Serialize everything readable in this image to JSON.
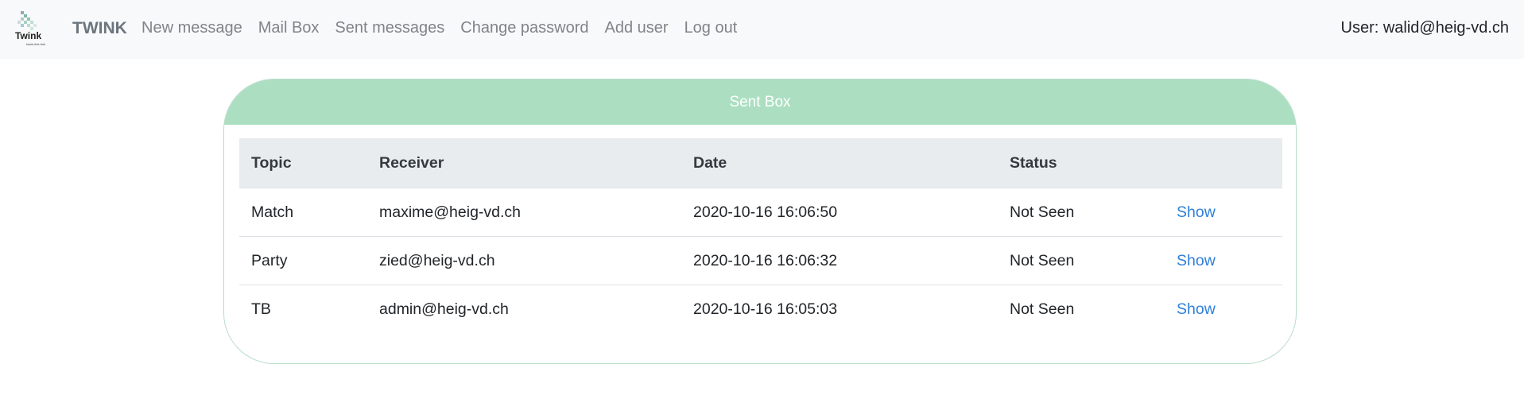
{
  "navbar": {
    "logo_text": "Twink",
    "logo_tagline": "twink-link-tink",
    "brand": "TWINK",
    "links": [
      {
        "label": "New message"
      },
      {
        "label": "Mail Box"
      },
      {
        "label": "Sent messages"
      },
      {
        "label": "Change password"
      },
      {
        "label": "Add user"
      },
      {
        "label": "Log out"
      }
    ],
    "user_label": "User: walid@heig-vd.ch"
  },
  "sent_box": {
    "title": "Sent Box",
    "columns": [
      "Topic",
      "Receiver",
      "Date",
      "Status",
      ""
    ],
    "rows": [
      {
        "topic": "Match",
        "receiver": "maxime@heig-vd.ch",
        "date": "2020-10-16 16:06:50",
        "status": "Not Seen",
        "action": "Show"
      },
      {
        "topic": "Party",
        "receiver": "zied@heig-vd.ch",
        "date": "2020-10-16 16:06:32",
        "status": "Not Seen",
        "action": "Show"
      },
      {
        "topic": "TB",
        "receiver": "admin@heig-vd.ch",
        "date": "2020-10-16 16:05:03",
        "status": "Not Seen",
        "action": "Show"
      }
    ]
  },
  "colors": {
    "navbar_bg": "#f8f9fa",
    "header_green": "#acdfc1",
    "table_header_bg": "#e9ecef",
    "link_blue": "#2f80d8"
  }
}
